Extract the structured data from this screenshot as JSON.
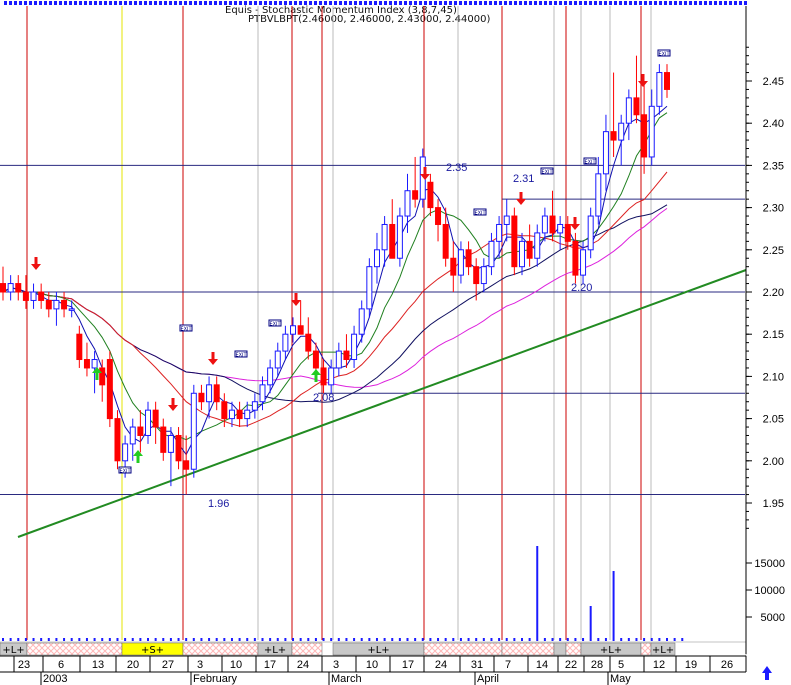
{
  "header": {
    "line1": "Equis - Stochastic Momentum Index (3,8,7,45)",
    "line2": "PTBVLBPT(2.46000, 2.46000, 2.43000, 2.44000)"
  },
  "colors": {
    "background": "#ffffff",
    "up_bar": "#1a1aff",
    "down_bar": "#ff0000",
    "trendline": "#228b22",
    "ma_short": "#1010b0",
    "ma_mid": "#208020",
    "ma_red": "#dd2222",
    "ma_magenta": "#dd22dd",
    "ma_long": "#101060",
    "marker_red": "#ee1111",
    "marker_green": "#22cc22",
    "band_pink": "#ffb8b8",
    "band_gray": "#c8c8c8",
    "band_yellow": "#ffff00"
  },
  "chart_data": {
    "type": "candlestick",
    "y_range": [
      1.9,
      2.49
    ],
    "y_ticks": [
      "2.45",
      "2.40",
      "2.35",
      "2.30",
      "2.25",
      "2.20",
      "2.15",
      "2.10",
      "2.05",
      "2.00",
      "1.95"
    ],
    "volume_ticks": [
      "15000",
      "10000",
      "5000"
    ],
    "x_tick_labels": [
      "23",
      "6",
      "13",
      "20",
      "27",
      "3",
      "10",
      "17",
      "24",
      "3",
      "10",
      "17",
      "24",
      "31",
      "7",
      "14",
      "22",
      "28",
      "5",
      "12",
      "19",
      "26"
    ],
    "month_labels": [
      "2003",
      "February",
      "March",
      "April",
      "May"
    ],
    "level_lines": [
      {
        "value": 2.35,
        "label": "2.35"
      },
      {
        "value": 2.31,
        "label": "2.31"
      },
      {
        "value": 2.2,
        "label": "2.20"
      },
      {
        "value": 2.08,
        "label": "2.08"
      },
      {
        "value": 1.96,
        "label": "1.96"
      }
    ],
    "band_labels": {
      "long": "+L+",
      "short": "+S+"
    },
    "marker_text": "EXIT",
    "candles": [
      {
        "o": 2.21,
        "h": 2.23,
        "l": 2.19,
        "c": 2.2
      },
      {
        "o": 2.2,
        "h": 2.22,
        "l": 2.19,
        "c": 2.21
      },
      {
        "o": 2.21,
        "h": 2.22,
        "l": 2.19,
        "c": 2.2
      },
      {
        "o": 2.2,
        "h": 2.22,
        "l": 2.18,
        "c": 2.19
      },
      {
        "o": 2.19,
        "h": 2.21,
        "l": 2.18,
        "c": 2.2
      },
      {
        "o": 2.2,
        "h": 2.21,
        "l": 2.18,
        "c": 2.19
      },
      {
        "o": 2.19,
        "h": 2.2,
        "l": 2.17,
        "c": 2.18
      },
      {
        "o": 2.18,
        "h": 2.2,
        "l": 2.16,
        "c": 2.19
      },
      {
        "o": 2.19,
        "h": 2.2,
        "l": 2.17,
        "c": 2.18
      },
      {
        "o": 2.18,
        "h": 2.19,
        "l": 2.17,
        "c": 2.18
      },
      {
        "o": 2.15,
        "h": 2.16,
        "l": 2.11,
        "c": 2.12
      },
      {
        "o": 2.12,
        "h": 2.14,
        "l": 2.1,
        "c": 2.11
      },
      {
        "o": 2.11,
        "h": 2.13,
        "l": 2.08,
        "c": 2.12
      },
      {
        "o": 2.11,
        "h": 2.12,
        "l": 2.07,
        "c": 2.09
      },
      {
        "o": 2.12,
        "h": 2.13,
        "l": 2.04,
        "c": 2.05
      },
      {
        "o": 2.05,
        "h": 2.06,
        "l": 1.99,
        "c": 2.0
      },
      {
        "o": 2.0,
        "h": 2.03,
        "l": 1.98,
        "c": 2.02
      },
      {
        "o": 2.02,
        "h": 2.05,
        "l": 2.0,
        "c": 2.04
      },
      {
        "o": 2.04,
        "h": 2.06,
        "l": 2.01,
        "c": 2.03
      },
      {
        "o": 2.03,
        "h": 2.07,
        "l": 2.02,
        "c": 2.06
      },
      {
        "o": 2.06,
        "h": 2.07,
        "l": 2.02,
        "c": 2.04
      },
      {
        "o": 2.04,
        "h": 2.05,
        "l": 2.0,
        "c": 2.01
      },
      {
        "o": 2.01,
        "h": 2.04,
        "l": 1.97,
        "c": 2.03
      },
      {
        "o": 2.03,
        "h": 2.04,
        "l": 1.99,
        "c": 2.0
      },
      {
        "o": 2.0,
        "h": 2.03,
        "l": 1.96,
        "c": 1.99
      },
      {
        "o": 1.99,
        "h": 2.09,
        "l": 1.98,
        "c": 2.08
      },
      {
        "o": 2.08,
        "h": 2.09,
        "l": 2.06,
        "c": 2.07
      },
      {
        "o": 2.07,
        "h": 2.1,
        "l": 2.05,
        "c": 2.09
      },
      {
        "o": 2.09,
        "h": 2.1,
        "l": 2.06,
        "c": 2.07
      },
      {
        "o": 2.07,
        "h": 2.08,
        "l": 2.04,
        "c": 2.05
      },
      {
        "o": 2.05,
        "h": 2.07,
        "l": 2.04,
        "c": 2.06
      },
      {
        "o": 2.06,
        "h": 2.07,
        "l": 2.04,
        "c": 2.05
      },
      {
        "o": 2.05,
        "h": 2.07,
        "l": 2.04,
        "c": 2.06
      },
      {
        "o": 2.06,
        "h": 2.08,
        "l": 2.05,
        "c": 2.07
      },
      {
        "o": 2.07,
        "h": 2.1,
        "l": 2.06,
        "c": 2.09
      },
      {
        "o": 2.09,
        "h": 2.12,
        "l": 2.08,
        "c": 2.11
      },
      {
        "o": 2.11,
        "h": 2.14,
        "l": 2.1,
        "c": 2.13
      },
      {
        "o": 2.13,
        "h": 2.16,
        "l": 2.12,
        "c": 2.15
      },
      {
        "o": 2.15,
        "h": 2.17,
        "l": 2.14,
        "c": 2.16
      },
      {
        "o": 2.16,
        "h": 2.19,
        "l": 2.15,
        "c": 2.15
      },
      {
        "o": 2.15,
        "h": 2.17,
        "l": 2.12,
        "c": 2.13
      },
      {
        "o": 2.13,
        "h": 2.14,
        "l": 2.1,
        "c": 2.11
      },
      {
        "o": 2.11,
        "h": 2.12,
        "l": 2.08,
        "c": 2.09
      },
      {
        "o": 2.09,
        "h": 2.12,
        "l": 2.08,
        "c": 2.11
      },
      {
        "o": 2.11,
        "h": 2.14,
        "l": 2.1,
        "c": 2.13
      },
      {
        "o": 2.13,
        "h": 2.15,
        "l": 2.11,
        "c": 2.12
      },
      {
        "o": 2.12,
        "h": 2.16,
        "l": 2.11,
        "c": 2.15
      },
      {
        "o": 2.15,
        "h": 2.19,
        "l": 2.14,
        "c": 2.18
      },
      {
        "o": 2.18,
        "h": 2.24,
        "l": 2.17,
        "c": 2.23
      },
      {
        "o": 2.23,
        "h": 2.27,
        "l": 2.21,
        "c": 2.25
      },
      {
        "o": 2.25,
        "h": 2.29,
        "l": 2.23,
        "c": 2.28
      },
      {
        "o": 2.28,
        "h": 2.31,
        "l": 2.26,
        "c": 2.24
      },
      {
        "o": 2.24,
        "h": 2.3,
        "l": 2.23,
        "c": 2.29
      },
      {
        "o": 2.29,
        "h": 2.34,
        "l": 2.27,
        "c": 2.32
      },
      {
        "o": 2.32,
        "h": 2.36,
        "l": 2.3,
        "c": 2.31
      },
      {
        "o": 2.31,
        "h": 2.37,
        "l": 2.3,
        "c": 2.36
      },
      {
        "o": 2.33,
        "h": 2.34,
        "l": 2.29,
        "c": 2.3
      },
      {
        "o": 2.3,
        "h": 2.31,
        "l": 2.26,
        "c": 2.28
      },
      {
        "o": 2.28,
        "h": 2.3,
        "l": 2.23,
        "c": 2.24
      },
      {
        "o": 2.24,
        "h": 2.26,
        "l": 2.2,
        "c": 2.22
      },
      {
        "o": 2.22,
        "h": 2.26,
        "l": 2.21,
        "c": 2.25
      },
      {
        "o": 2.25,
        "h": 2.26,
        "l": 2.22,
        "c": 2.23
      },
      {
        "o": 2.23,
        "h": 2.24,
        "l": 2.19,
        "c": 2.21
      },
      {
        "o": 2.21,
        "h": 2.24,
        "l": 2.2,
        "c": 2.23
      },
      {
        "o": 2.23,
        "h": 2.27,
        "l": 2.22,
        "c": 2.26
      },
      {
        "o": 2.26,
        "h": 2.29,
        "l": 2.24,
        "c": 2.28
      },
      {
        "o": 2.28,
        "h": 2.31,
        "l": 2.26,
        "c": 2.29
      },
      {
        "o": 2.29,
        "h": 2.3,
        "l": 2.22,
        "c": 2.23
      },
      {
        "o": 2.23,
        "h": 2.27,
        "l": 2.22,
        "c": 2.26
      },
      {
        "o": 2.26,
        "h": 2.28,
        "l": 2.23,
        "c": 2.24
      },
      {
        "o": 2.24,
        "h": 2.28,
        "l": 2.23,
        "c": 2.27
      },
      {
        "o": 2.27,
        "h": 2.3,
        "l": 2.26,
        "c": 2.29
      },
      {
        "o": 2.29,
        "h": 2.32,
        "l": 2.26,
        "c": 2.27
      },
      {
        "o": 2.27,
        "h": 2.29,
        "l": 2.25,
        "c": 2.28
      },
      {
        "o": 2.28,
        "h": 2.29,
        "l": 2.25,
        "c": 2.26
      },
      {
        "o": 2.26,
        "h": 2.27,
        "l": 2.21,
        "c": 2.22
      },
      {
        "o": 2.22,
        "h": 2.26,
        "l": 2.21,
        "c": 2.25
      },
      {
        "o": 2.25,
        "h": 2.3,
        "l": 2.24,
        "c": 2.29
      },
      {
        "o": 2.29,
        "h": 2.36,
        "l": 2.28,
        "c": 2.34
      },
      {
        "o": 2.34,
        "h": 2.41,
        "l": 2.32,
        "c": 2.39
      },
      {
        "o": 2.39,
        "h": 2.46,
        "l": 2.36,
        "c": 2.38
      },
      {
        "o": 2.38,
        "h": 2.41,
        "l": 2.35,
        "c": 2.4
      },
      {
        "o": 2.4,
        "h": 2.44,
        "l": 2.38,
        "c": 2.43
      },
      {
        "o": 2.43,
        "h": 2.48,
        "l": 2.4,
        "c": 2.41
      },
      {
        "o": 2.41,
        "h": 2.45,
        "l": 2.34,
        "c": 2.36
      },
      {
        "o": 2.36,
        "h": 2.44,
        "l": 2.35,
        "c": 2.42
      },
      {
        "o": 2.42,
        "h": 2.47,
        "l": 2.41,
        "c": 2.46
      },
      {
        "o": 2.46,
        "h": 2.47,
        "l": 2.43,
        "c": 2.44
      }
    ]
  }
}
